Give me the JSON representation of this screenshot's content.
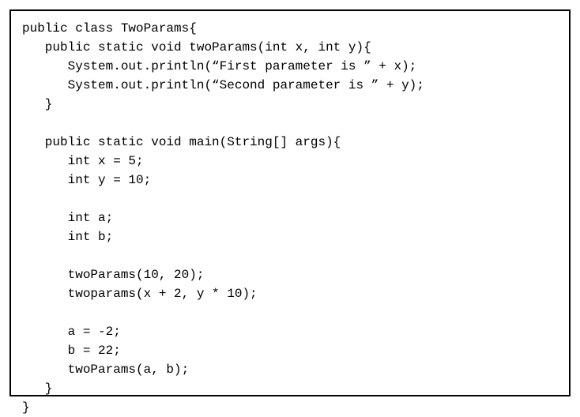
{
  "code": {
    "lines": [
      "public class TwoParams{",
      "   public static void twoParams(int x, int y){",
      "      System.out.println(“First parameter is ” + x);",
      "      System.out.println(“Second parameter is ” + y);",
      "   }",
      "",
      "   public static void main(String[] args){",
      "      int x = 5;",
      "      int y = 10;",
      "",
      "      int a;",
      "      int b;",
      "",
      "      twoParams(10, 20);",
      "      twoparams(x + 2, y * 10);",
      "",
      "      a = -2;",
      "      b = 22;",
      "      twoParams(a, b);",
      "   }",
      "}"
    ]
  }
}
